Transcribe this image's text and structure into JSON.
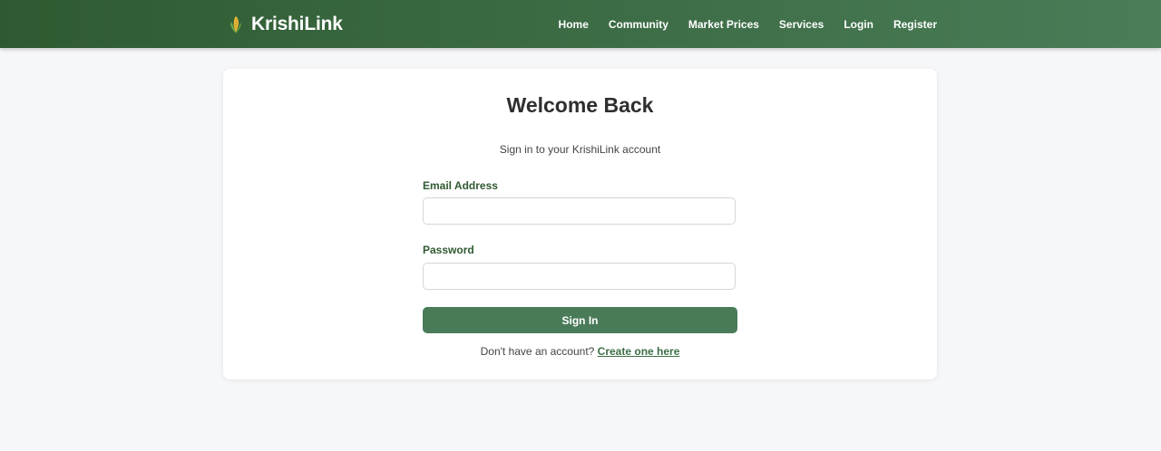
{
  "brand": {
    "name": "KrishiLink",
    "icon": "corn-icon"
  },
  "nav": {
    "items": [
      {
        "label": "Home"
      },
      {
        "label": "Community"
      },
      {
        "label": "Market Prices"
      },
      {
        "label": "Services"
      },
      {
        "label": "Login"
      },
      {
        "label": "Register"
      }
    ]
  },
  "login": {
    "title": "Welcome Back",
    "subtitle": "Sign in to your KrishiLink account",
    "email_label": "Email Address",
    "email_value": "",
    "password_label": "Password",
    "password_value": "",
    "submit_label": "Sign In",
    "signup_prompt": "Don't have an account?",
    "signup_link": "Create one here"
  },
  "colors": {
    "header_start": "#2f5a31",
    "header_end": "#4a7d58",
    "accent": "#4a7b59",
    "background": "#f6f7f9"
  }
}
